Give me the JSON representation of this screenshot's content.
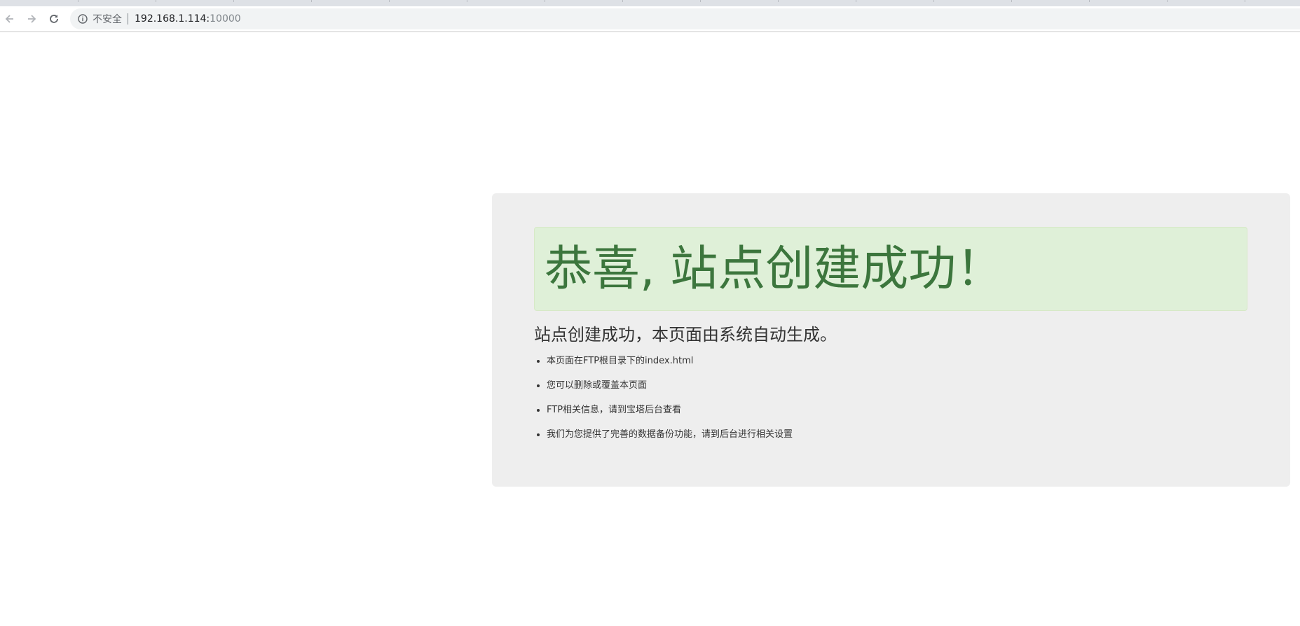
{
  "browser": {
    "back_icon": "arrow-left-icon",
    "forward_icon": "arrow-right-icon",
    "reload_icon": "reload-icon",
    "info_icon": "info-circle-icon",
    "security_label": "不安全",
    "url_host": "192.168.1.114:",
    "url_port": "10000"
  },
  "page": {
    "heading": "恭喜, 站点创建成功！",
    "lead": "站点创建成功，本页面由系统自动生成。",
    "items": [
      "本页面在FTP根目录下的index.html",
      "您可以删除或覆盖本页面",
      "FTP相关信息，请到宝塔后台查看",
      "我们为您提供了完善的数据备份功能，请到后台进行相关设置"
    ]
  },
  "colors": {
    "jumbotron_bg": "#eeeeee",
    "alert_bg": "#dff0d8",
    "alert_text": "#3c763d",
    "text": "#333333"
  }
}
